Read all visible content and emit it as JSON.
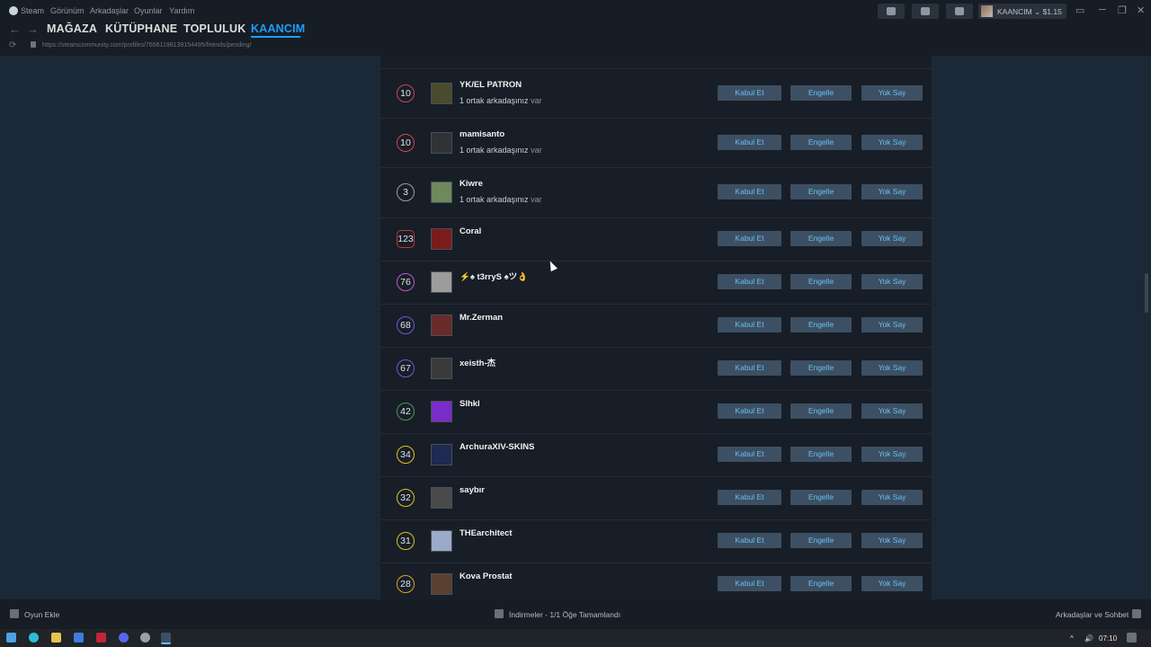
{
  "titlebar": {
    "menu": [
      "Steam",
      "Görünüm",
      "Arkadaşlar",
      "Oyunlar",
      "Yardım"
    ],
    "account_label": "KAANCIM ⌄ $1.15"
  },
  "navbar": {
    "tabs": [
      "MAĞAZA",
      "KÜTÜPHANE",
      "TOPLULUK",
      "KAANCIM"
    ],
    "active_tab": "KAANCIM",
    "url": "https://steamcommunity.com/profiles/76561198139154495/friends/pending/"
  },
  "requests": [
    {
      "level": "10",
      "name": "YK/EL PATRON",
      "mutual": "1 ortak arkadaşınız",
      "mutual_suffix": "var",
      "level_color": "#d9404e",
      "avatar": "#4a4a2e"
    },
    {
      "level": "10",
      "name": "mamisanto",
      "mutual": "1 ortak arkadaşınız",
      "mutual_suffix": "var",
      "level_color": "#d9404e",
      "avatar": "#2f3236"
    },
    {
      "level": "3",
      "name": "Kiwre",
      "mutual": "1 ortak arkadaşınız",
      "mutual_suffix": "var",
      "level_color": "#9aa0a6",
      "avatar": "#6e8a5c"
    },
    {
      "level": "123",
      "name": "Coral",
      "mutual": "",
      "mutual_suffix": "",
      "level_color": "#c0392b",
      "avatar": "#7a1c1c"
    },
    {
      "level": "76",
      "name": "⚡♠ t3rryS ♠ツ👌",
      "mutual": "",
      "mutual_suffix": "",
      "level_color": "#c056d6",
      "avatar": "#9c9c9c"
    },
    {
      "level": "68",
      "name": "Mr.Zerman",
      "mutual": "",
      "mutual_suffix": "",
      "level_color": "#6e5ad6",
      "avatar": "#6a2a2a"
    },
    {
      "level": "67",
      "name": "xeisth-杰",
      "mutual": "",
      "mutual_suffix": "",
      "level_color": "#6e5ad6",
      "avatar": "#3a3a3a"
    },
    {
      "level": "42",
      "name": "Slhkl",
      "mutual": "",
      "mutual_suffix": "",
      "level_color": "#4c9a4c",
      "avatar": "#7a2cc8"
    },
    {
      "level": "34",
      "name": "ArchuraXIV-SKINS",
      "mutual": "",
      "mutual_suffix": "",
      "level_color": "#e0c21c",
      "avatar": "#1e2a52"
    },
    {
      "level": "32",
      "name": "saybır",
      "mutual": "",
      "mutual_suffix": "",
      "level_color": "#e0c21c",
      "avatar": "#4a4a4a"
    },
    {
      "level": "31",
      "name": "THEarchitect",
      "mutual": "",
      "mutual_suffix": "",
      "level_color": "#e0c21c",
      "avatar": "#9aaac8"
    },
    {
      "level": "28",
      "name": "Kova Prostat",
      "mutual": "",
      "mutual_suffix": "",
      "level_color": "#e0a01c",
      "avatar": "#5a4030"
    }
  ],
  "buttons": {
    "accept": "Kabul Et",
    "block": "Engelle",
    "ignore": "Yok Say"
  },
  "bottombar": {
    "add_game": "Oyun Ekle",
    "downloads": "İndirmeler - 1/1 Öğe Tamamlandı",
    "friends_chat": "Arkadaşlar ve Sohbet"
  },
  "taskbar": {
    "time": "07:10"
  }
}
